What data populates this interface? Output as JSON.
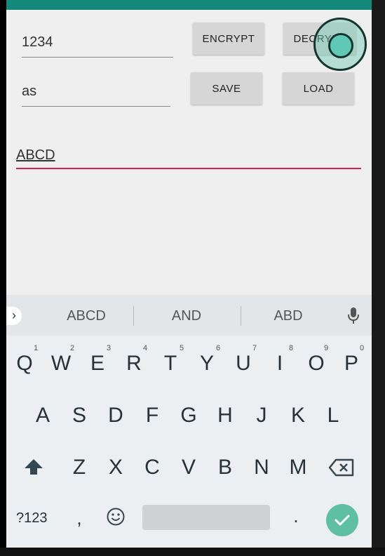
{
  "form": {
    "key_value": "1234",
    "filename_value": "as",
    "text_value": "ABCD"
  },
  "buttons": {
    "encrypt": "ENCRYPT",
    "decrypt": "DECRYPT",
    "save": "SAVE",
    "load": "LOAD"
  },
  "keyboard": {
    "suggestions": [
      "ABCD",
      "AND",
      "ABD"
    ],
    "row1": [
      "Q",
      "W",
      "E",
      "R",
      "T",
      "Y",
      "U",
      "I",
      "O",
      "P"
    ],
    "row1_hints": [
      "1",
      "2",
      "3",
      "4",
      "5",
      "6",
      "7",
      "8",
      "9",
      "0"
    ],
    "row2": [
      "A",
      "S",
      "D",
      "F",
      "G",
      "H",
      "J",
      "K",
      "L"
    ],
    "row3": [
      "Z",
      "X",
      "C",
      "V",
      "B",
      "N",
      "M"
    ],
    "symbols_label": "?123",
    "comma": ",",
    "period": ".",
    "icons": {
      "expand": "chevron-right-icon",
      "mic": "microphone-icon",
      "shift": "shift-icon",
      "backspace": "backspace-icon",
      "emoji": "emoji-icon",
      "enter": "checkmark-icon"
    },
    "colors": {
      "accent": "#5fbfa3",
      "cursor_line": "#d81b60",
      "status_bar": "#12897a"
    }
  }
}
